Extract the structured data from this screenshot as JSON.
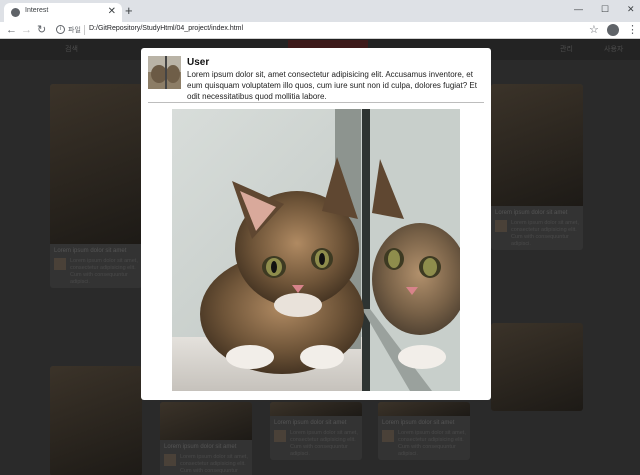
{
  "browser": {
    "tab_title": "Interest",
    "tab_close": "✕",
    "new_tab": "+",
    "window": {
      "minimize": "—",
      "maximize": "☐",
      "close": "✕"
    },
    "nav": {
      "back": "←",
      "forward": "→",
      "reload": "↻"
    },
    "address": {
      "info": "i",
      "scheme": "파일",
      "url": "D:/GitRepository/StudyHtml/04_project/index.html"
    },
    "star": "☆",
    "menu": "⋮"
  },
  "page": {
    "header": {
      "search": "검색",
      "link_1": "관리",
      "link_2": "사용자"
    },
    "cards": [
      {
        "caption": "Lorem ipsum dolor sit amet"
      },
      {
        "caption": "Lorem ipsum dolor sit amet"
      },
      {
        "caption": "Lorem ipsum dolor sit amet"
      },
      {
        "caption": "Lorem ipsum dolor sit amet"
      },
      {
        "caption": "Lorem ipsum dolor sit amet"
      }
    ],
    "card_text": "Lorem ipsum dolor sit amet, consectetur adipisicing elit. Cum with consequuntur adipisci."
  },
  "modal": {
    "username": "User",
    "text": "Lorem ipsum dolor sit, amet consectetur adipisicing elit. Accusamus inventore, et eum quisquam voluptatem illo quos, cum iure sunt non id culpa, dolores fugiat? Et odit necessitatibus quod mollitia labore."
  }
}
